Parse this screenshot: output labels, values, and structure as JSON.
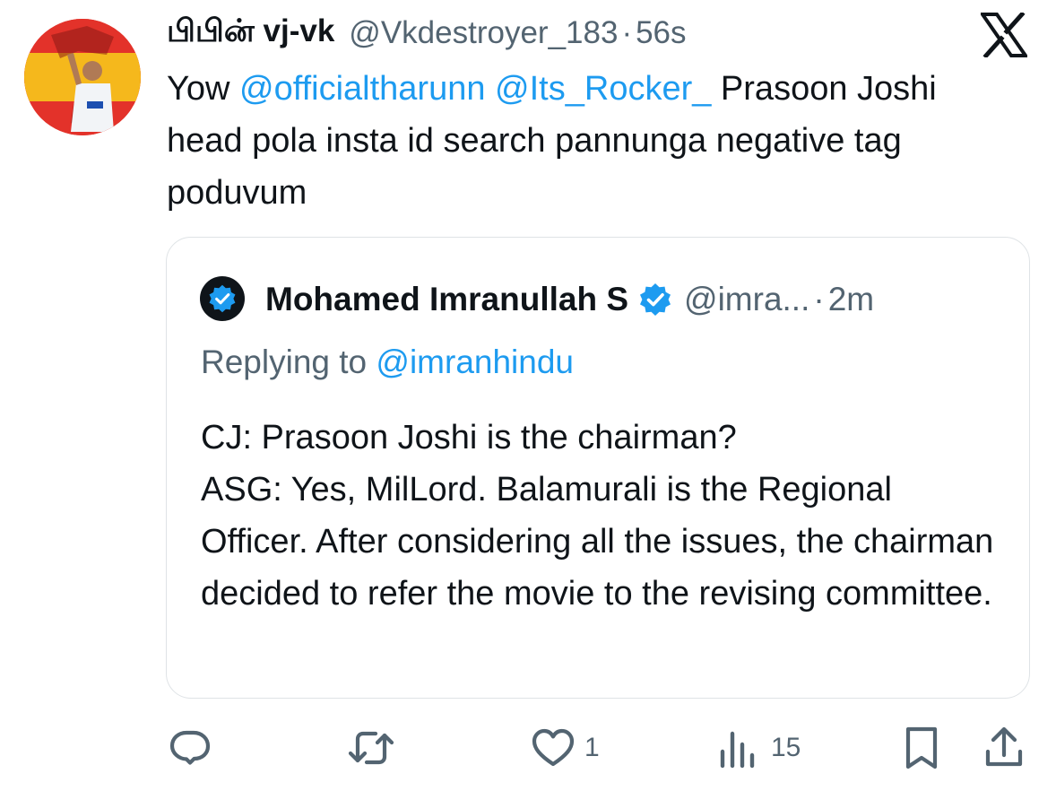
{
  "tweet": {
    "display_name": "பிபின் vj-vk",
    "handle": "@Vkdestroyer_183",
    "separator": "·",
    "time": "56s",
    "text_prefix": "Yow ",
    "mention_1": "@officialtharunn",
    "mention_2": "@Its_Rocker_",
    "text_suffix": " Prasoon Joshi head pola insta id search pannunga negative tag poduvum"
  },
  "quote": {
    "display_name": "Mohamed Imranullah S",
    "handle": "@imra...",
    "separator": "·",
    "time": "2m",
    "replying_label": "Replying to ",
    "replying_handle": "@imranhindu",
    "line_1": "CJ: Prasoon Joshi is the chairman?",
    "line_2": "ASG: Yes, MilLord. Balamurali is the Regional Officer. After considering all the issues, the chairman decided to refer the movie to the revising committee."
  },
  "actions": {
    "like_count": "1",
    "views_count": "15"
  },
  "colors": {
    "link": "#1d9bf0",
    "secondary_text": "#536471",
    "primary_text": "#0f1419",
    "border": "#dfe3e6"
  },
  "icons": [
    "x-logo-icon",
    "verified-badge-icon",
    "reply-icon",
    "retweet-icon",
    "like-icon",
    "views-icon",
    "bookmark-icon",
    "share-icon"
  ]
}
